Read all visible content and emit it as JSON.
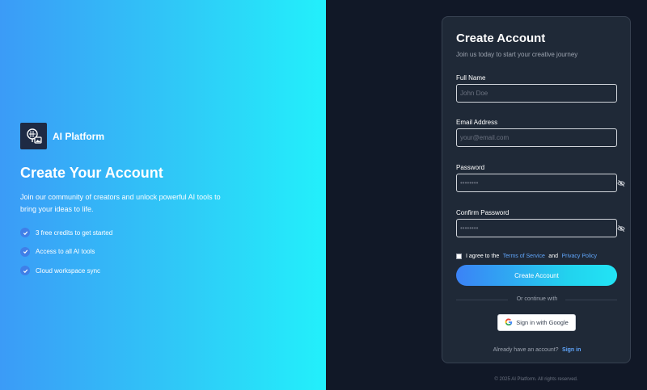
{
  "brand": {
    "name": "AI Platform",
    "logo_icon": "brain-image-icon",
    "accent_color": "#3b82f6"
  },
  "hero": {
    "title": "Create Your Account",
    "description": "Join our community of creators and unlock powerful AI tools to bring your ideas to life.",
    "features": [
      {
        "label": "3 free credits to get started",
        "icon": "check-circle-icon"
      },
      {
        "label": "Access to all AI tools",
        "icon": "check-circle-icon"
      },
      {
        "label": "Cloud workspace sync",
        "icon": "check-circle-icon"
      }
    ]
  },
  "form": {
    "title": "Create Account",
    "subtitle": "Join us today to start your creative journey",
    "full_name": {
      "label": "Full Name",
      "placeholder": "John Doe"
    },
    "email": {
      "label": "Email Address",
      "placeholder": "your@email.com"
    },
    "password": {
      "label": "Password",
      "placeholder": "••••••••",
      "toggle_icon": "eye-off-icon"
    },
    "confirm_password": {
      "label": "Confirm Password",
      "placeholder": "••••••••",
      "toggle_icon": "eye-off-icon"
    },
    "terms": {
      "prefix": "I agree to the",
      "terms_link": "Terms of Service",
      "and": "and",
      "privacy_link": "Privacy Policy",
      "checked": false
    },
    "submit_label": "Create Account",
    "divider_text": "Or continue with",
    "google_label": "Sign in with Google",
    "signin_prompt": "Already have an account?",
    "signin_link": "Sign in"
  },
  "footer": {
    "text": "© 2025 AI Platform. All rights reserved."
  }
}
